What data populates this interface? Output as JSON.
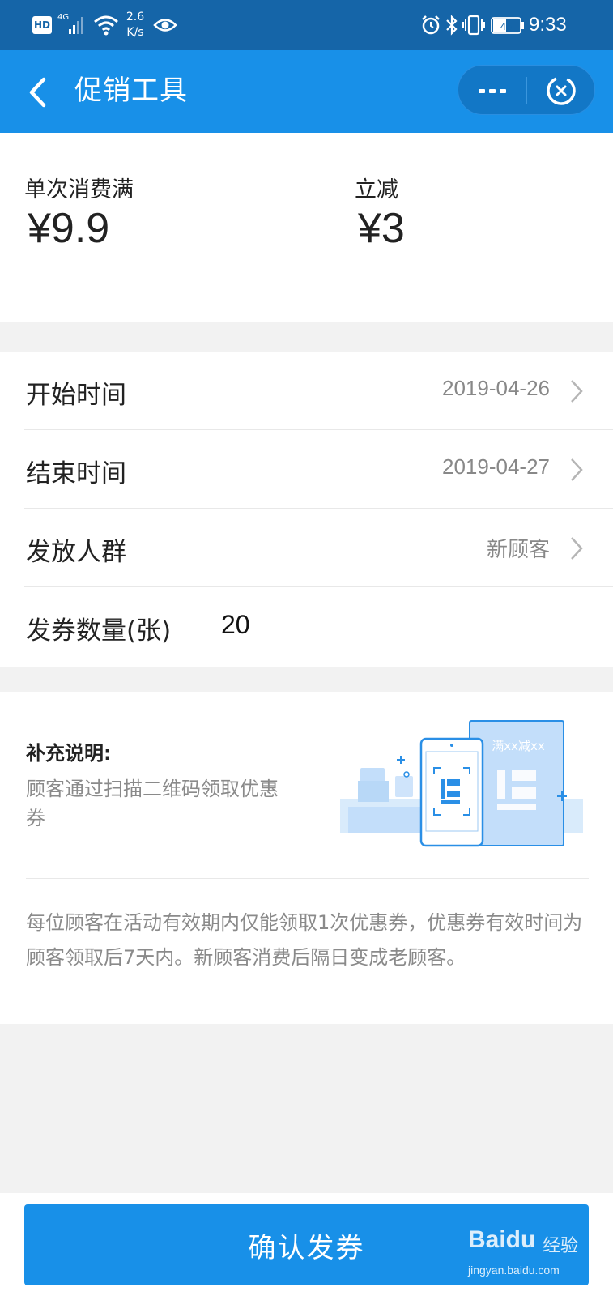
{
  "status_bar": {
    "hd": "HD",
    "network": "4G",
    "speed_value": "2.6",
    "speed_unit": "K/s",
    "battery": "46",
    "time": "9:33"
  },
  "nav": {
    "title": "促销工具"
  },
  "promo": {
    "threshold_label": "单次消费满",
    "threshold_value": "¥9.9",
    "discount_label": "立减",
    "discount_value": "¥3"
  },
  "settings": {
    "start_label": "开始时间",
    "start_value": "2019-04-26",
    "end_label": "结束时间",
    "end_value": "2019-04-27",
    "audience_label": "发放人群",
    "audience_value": "新顾客",
    "quantity_label": "发券数量(张)",
    "quantity_value": "20"
  },
  "supplement": {
    "title": "补充说明:",
    "description": "顾客通过扫描二维码领取优惠券",
    "illustration_text": "满xx减xx",
    "notice": "每位顾客在活动有效期内仅能领取1次优惠券，优惠券有效时间为顾客领取后7天内。新顾客消费后隔日变成老顾客。"
  },
  "footer": {
    "confirm_label": "确认发券"
  },
  "watermark": {
    "brand": "Baidu",
    "sub": "经验",
    "url": "jingyan.baidu.com"
  },
  "colors": {
    "status_bar": "#1565a8",
    "primary": "#1890e8",
    "background": "#f2f2f2"
  }
}
